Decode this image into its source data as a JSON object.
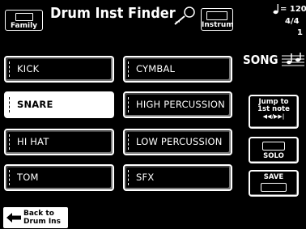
{
  "header": {
    "family_button": "Family",
    "title": "Drum Inst Finder",
    "instrum_button": "Instrum",
    "tempo_value": "= 120",
    "time_signature": "4/4",
    "measure": "1"
  },
  "instruments": {
    "left": [
      "KICK",
      "SNARE",
      "HI HAT",
      "TOM"
    ],
    "right": [
      "CYMBAL",
      "HIGH PERCUSSION",
      "LOW PERCUSSION",
      "SFX"
    ],
    "selected": "SNARE"
  },
  "side": {
    "song_label": "SONG",
    "jump_line1": "Jump to",
    "jump_line2": "1st note",
    "jump_arrows": "◀◀/▶▶|",
    "solo_label": "SOLO",
    "save_label": "SAVE"
  },
  "footer": {
    "back_line1": "Back to",
    "back_line2": "Drum Ins"
  },
  "icons": {
    "magnifier": "magnifier-icon",
    "quarter_note": "quarter-note-icon",
    "song_staff": "song-staff-icon",
    "back_arrow": "back-arrow-icon"
  }
}
